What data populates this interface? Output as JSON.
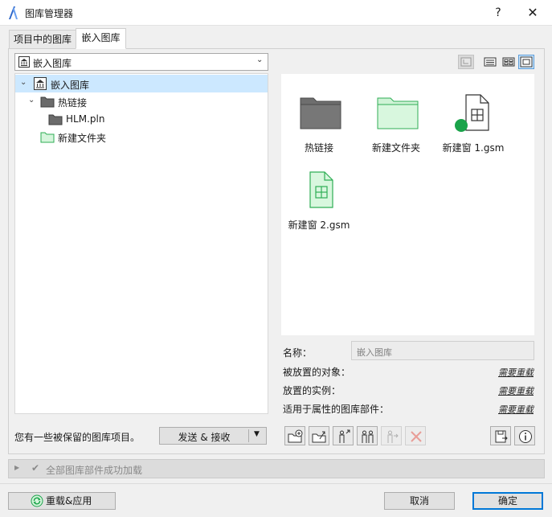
{
  "window": {
    "title": "图库管理器",
    "help": "?",
    "close": "✕"
  },
  "tabs": [
    {
      "label": "项目中的图库",
      "active": false
    },
    {
      "label": "嵌入图库",
      "active": true
    }
  ],
  "library_select": {
    "value": "嵌入图库"
  },
  "tree": [
    {
      "label": "嵌入图库",
      "icon": "library-icon",
      "level": 0,
      "expanded": true,
      "selected": true
    },
    {
      "label": "热链接",
      "icon": "folder-icon",
      "level": 1,
      "expanded": true,
      "selected": false
    },
    {
      "label": "HLM.pln",
      "icon": "folder-icon",
      "level": 2,
      "selected": false
    },
    {
      "label": "新建文件夹",
      "icon": "green-folder-icon",
      "level": 1,
      "selected": false
    }
  ],
  "preview_items": [
    {
      "label": "热链接",
      "icon": "gray-folder-icon"
    },
    {
      "label": "新建文件夹",
      "icon": "green-folder-icon"
    },
    {
      "label": "新建窗 1.gsm",
      "icon": "window-object-icon"
    },
    {
      "label": "新建窗 2.gsm",
      "icon": "green-window-object-icon"
    }
  ],
  "info": {
    "name_label": "名称：",
    "name_value": "嵌入图库",
    "placed_objects_label": "被放置的对象：",
    "placed_objects_value": "需要重载",
    "placed_instances_label": "放置的实例：",
    "placed_instances_value": "需要重载",
    "attribute_parts_label": "适用于属性的图库部件：",
    "attribute_parts_value": "需要重载"
  },
  "reserved_text": "您有一些被保留的图库项目。",
  "send_receive": {
    "label": "发送 & 接收"
  },
  "status": {
    "text": "全部图库部件成功加载"
  },
  "footer": {
    "reload_label": "重载&应用",
    "cancel_label": "取消",
    "ok_label": "确定"
  },
  "colors": {
    "accent": "#0078d7",
    "selection": "#cce8ff",
    "green": "#1aa34a"
  }
}
